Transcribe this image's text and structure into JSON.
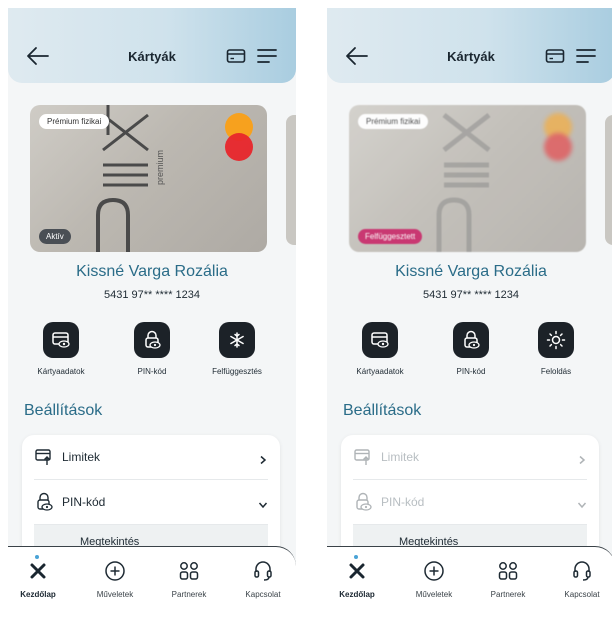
{
  "screens": [
    {
      "header": {
        "title": "Kártyák"
      },
      "card": {
        "type_badge": "Prémium fizikai",
        "brand": "premium",
        "status": "Aktív"
      },
      "holder_name": "Kissné Varga Rozália",
      "card_number": "5431 97** **** 1234",
      "actions": [
        {
          "label": "Kártyaadatok",
          "icon": "card-eye-icon"
        },
        {
          "label": "PIN-kód",
          "icon": "lock-eye-icon"
        },
        {
          "label": "Felfüggesztés",
          "icon": "snowflake-icon"
        }
      ],
      "settings_title": "Beállítások",
      "settings": [
        {
          "label": "Limitek",
          "icon": "limits-icon",
          "chevron": "chevron-right-icon"
        },
        {
          "label": "PIN-kód",
          "icon": "lock-eye-icon",
          "chevron": "chevron-down-icon"
        }
      ],
      "sub_item": "Megtekintés"
    },
    {
      "header": {
        "title": "Kártyák"
      },
      "card": {
        "type_badge": "Prémium fizikai",
        "status": "Felfüggesztett"
      },
      "holder_name": "Kissné Varga Rozália",
      "card_number": "5431 97** **** 1234",
      "actions": [
        {
          "label": "Kártyaadatok",
          "icon": "card-eye-icon"
        },
        {
          "label": "PIN-kód",
          "icon": "lock-eye-icon"
        },
        {
          "label": "Feloldás",
          "icon": "sun-icon"
        }
      ],
      "settings_title": "Beállítások",
      "settings": [
        {
          "label": "Limitek",
          "icon": "limits-icon",
          "chevron": "chevron-right-icon"
        },
        {
          "label": "PIN-kód",
          "icon": "lock-eye-icon",
          "chevron": "chevron-down-icon"
        }
      ],
      "sub_item": "Megtekintés"
    }
  ],
  "bottom_nav": [
    {
      "label": "Kezdőlap",
      "icon": "home-x-icon",
      "active": true
    },
    {
      "label": "Műveletek",
      "icon": "plus-circle-icon",
      "active": false
    },
    {
      "label": "Partnerek",
      "icon": "partners-icon",
      "active": false
    },
    {
      "label": "Kapcsolat",
      "icon": "headset-icon",
      "active": false
    }
  ],
  "colors": {
    "accent": "#2a6c88",
    "status_active": "#4a4f55",
    "status_blocked": "#c2185b",
    "icon_button": "#1c2228"
  }
}
